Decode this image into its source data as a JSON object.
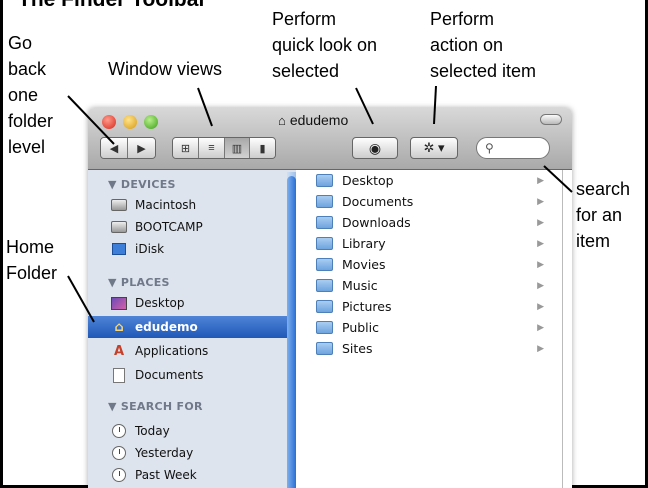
{
  "title": "The Finder Toolbar",
  "annotations": {
    "back": [
      "Go",
      "back",
      "one",
      "folder",
      "level"
    ],
    "views": [
      "Window views"
    ],
    "quicklook": [
      "Perform",
      "quick look on",
      "selected"
    ],
    "action": [
      "Perform",
      "action on",
      "selected item"
    ],
    "search": [
      "search",
      "for an",
      "item"
    ],
    "home": [
      "Home",
      "Folder"
    ]
  },
  "window": {
    "title": "edudemo",
    "home_icon": "⌂",
    "back_glyph": "◀",
    "forward_glyph": "▶",
    "view_glyphs": [
      "⊞",
      "≡",
      "▥",
      "▮"
    ],
    "eye_glyph": "◉",
    "gear_glyph": "✲ ▾",
    "search_glyph": "⚲"
  },
  "sidebar": {
    "devices_head": "▼ DEVICES",
    "devices": [
      "Macintosh",
      "BOOTCAMP",
      "iDisk"
    ],
    "places_head": "▼ PLACES",
    "places": [
      "Desktop",
      "edudemo",
      "Applications",
      "Documents"
    ],
    "search_head": "▼ SEARCH FOR",
    "search_for": [
      "Today",
      "Yesterday",
      "Past Week"
    ]
  },
  "folders": [
    "Desktop",
    "Documents",
    "Downloads",
    "Library",
    "Movies",
    "Music",
    "Pictures",
    "Public",
    "Sites"
  ],
  "row_arrow": "▶",
  "selected_place": "edudemo"
}
